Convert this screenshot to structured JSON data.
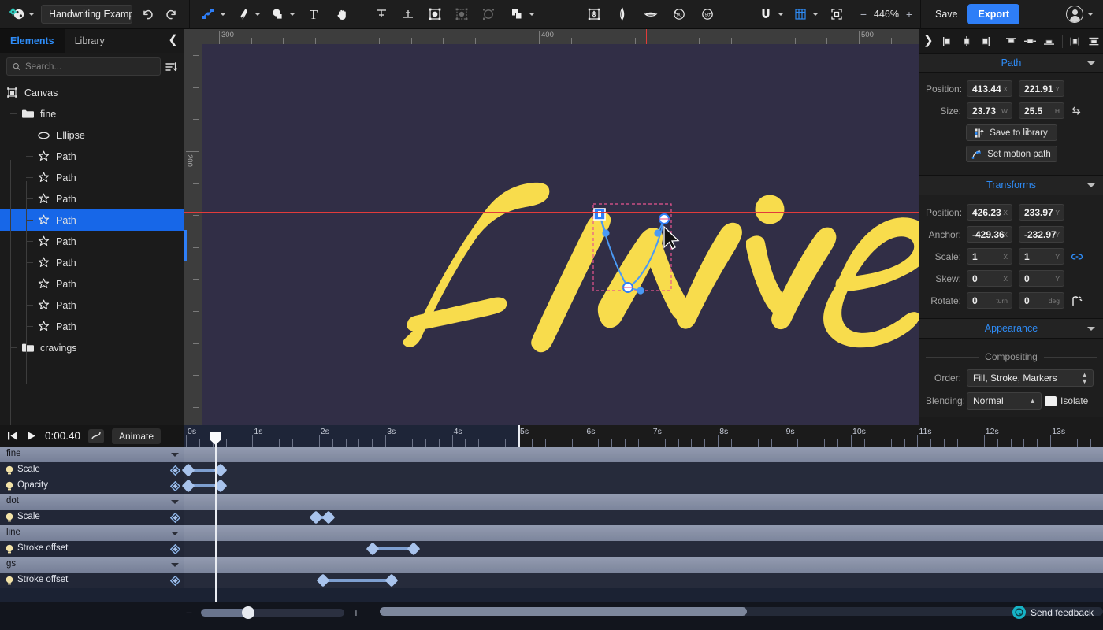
{
  "toolbar": {
    "logo_icon": "app-logo-icon",
    "project_name": "Handwriting Example",
    "undo_icon": "undo-icon",
    "redo_icon": "redo-icon",
    "tools": [
      {
        "name": "node-tool-icon",
        "label": "Node tool"
      },
      {
        "name": "pen-tool-icon",
        "label": "Pen tool"
      },
      {
        "name": "shape-tool-icon",
        "label": "Shape tool"
      },
      {
        "name": "text-tool-icon",
        "label": "Text tool"
      },
      {
        "name": "hand-tool-icon",
        "label": "Hand tool"
      }
    ],
    "path_ops": [
      {
        "name": "align-top-icon"
      },
      {
        "name": "align-bottom-icon"
      },
      {
        "name": "frame-selection-icon"
      },
      {
        "name": "group-selection-icon"
      },
      {
        "name": "mask-selection-icon"
      },
      {
        "name": "boolean-ops-icon"
      }
    ],
    "transform_ops": [
      {
        "name": "anchor-center-icon"
      },
      {
        "name": "flip-horizontal-icon"
      },
      {
        "name": "flip-vertical-icon"
      },
      {
        "name": "rotate-ccw-icon"
      },
      {
        "name": "rotate-cw-icon"
      }
    ],
    "snap_icon": "magnet-snap-icon",
    "grid_icon": "grid-icon",
    "fit_icon": "fit-to-screen-icon",
    "zoom_minus": "−",
    "zoom_level": "446%",
    "zoom_plus": "+",
    "save_label": "Save",
    "export_label": "Export",
    "account_icon": "user-avatar-icon"
  },
  "left_panel": {
    "tabs": [
      {
        "label": "Elements",
        "active": true
      },
      {
        "label": "Library",
        "active": false
      }
    ],
    "collapse_icon": "chevron-left-icon",
    "search": {
      "placeholder": "Search...",
      "value": "",
      "icon": "search-icon"
    },
    "sort_icon": "sort-icon",
    "tree": [
      {
        "label": "Canvas",
        "icon": "canvas-icon",
        "depth": 0,
        "selected": false
      },
      {
        "label": "fine",
        "icon": "folder-icon",
        "depth": 1,
        "selected": false
      },
      {
        "label": "Ellipse",
        "icon": "ellipse-icon",
        "depth": 2,
        "selected": false
      },
      {
        "label": "Path",
        "icon": "path-icon",
        "depth": 2,
        "selected": false
      },
      {
        "label": "Path",
        "icon": "path-icon",
        "depth": 2,
        "selected": false
      },
      {
        "label": "Path",
        "icon": "path-icon",
        "depth": 2,
        "selected": false
      },
      {
        "label": "Path",
        "icon": "path-icon",
        "depth": 2,
        "selected": true
      },
      {
        "label": "Path",
        "icon": "path-icon",
        "depth": 2,
        "selected": false
      },
      {
        "label": "Path",
        "icon": "path-icon",
        "depth": 2,
        "selected": false
      },
      {
        "label": "Path",
        "icon": "path-icon",
        "depth": 2,
        "selected": false
      },
      {
        "label": "Path",
        "icon": "path-icon",
        "depth": 2,
        "selected": false
      },
      {
        "label": "Path",
        "icon": "path-icon",
        "depth": 2,
        "selected": false
      },
      {
        "label": "cravings",
        "icon": "folder-icon",
        "depth": 1,
        "selected": false
      }
    ]
  },
  "canvas": {
    "h_ruler_labels": [
      "300",
      "400",
      "500"
    ],
    "v_ruler_labels": [
      "200"
    ],
    "artboard_color": "#312e46",
    "artwork_text": "FINE",
    "artwork_color": "#f8dc4c",
    "selection_color": "#e8558f",
    "handle_color": "#2e7ef7"
  },
  "right_panel": {
    "expand_icon": "chevron-right-icon",
    "align_buttons": [
      {
        "name": "align-left-icon"
      },
      {
        "name": "align-center-h-icon"
      },
      {
        "name": "align-right-icon"
      },
      {
        "name": "align-top-icon"
      },
      {
        "name": "align-middle-v-icon"
      },
      {
        "name": "align-bottom-icon"
      },
      {
        "name": "distribute-h-icon"
      },
      {
        "name": "distribute-v-icon"
      }
    ],
    "sections": {
      "path": {
        "title": "Path",
        "position_label": "Position:",
        "position_x": "413.44",
        "position_y": "221.91",
        "size_label": "Size:",
        "size_w": "23.73",
        "size_h": "25.5",
        "unit_x": "X",
        "unit_y": "Y",
        "unit_w": "W",
        "unit_h": "H",
        "lock_ratio_icon": "lock-aspect-icon",
        "save_library_label": "Save to library",
        "save_library_icon": "save-library-icon",
        "motion_path_label": "Set motion path",
        "motion_path_icon": "motion-path-icon"
      },
      "transforms": {
        "title": "Transforms",
        "position_label": "Position:",
        "position_x": "426.23",
        "position_y": "233.97",
        "anchor_label": "Anchor:",
        "anchor_x": "-429.36",
        "anchor_y": "-232.97",
        "scale_label": "Scale:",
        "scale_x": "1",
        "scale_y": "1",
        "scale_link_icon": "link-icon",
        "skew_label": "Skew:",
        "skew_x": "0",
        "skew_y": "0",
        "rotate_label": "Rotate:",
        "rotate_turn": "0",
        "rotate_turn_unit": "turn",
        "rotate_deg": "0",
        "rotate_deg_unit": "deg",
        "rotate_icon": "rotate-origin-icon"
      },
      "appearance": {
        "title": "Appearance",
        "compositing_label": "Compositing",
        "order_label": "Order:",
        "order_value": "Fill, Stroke, Markers",
        "blending_label": "Blending:",
        "blending_value": "Normal",
        "isolate_label": "Isolate"
      }
    }
  },
  "timeline": {
    "skip_start_icon": "skip-to-start-icon",
    "play_icon": "play-icon",
    "current_time": "0:00.40",
    "easing_icon": "easing-curve-icon",
    "animate_label": "Animate",
    "ruler_labels": [
      "0s",
      "1s",
      "2s",
      "3s",
      "4s",
      "5s",
      "6s",
      "7s",
      "8s",
      "9s",
      "10s",
      "11s",
      "12s",
      "13s"
    ],
    "composition_end": "5s",
    "playhead_time": "0.40",
    "rows": [
      {
        "type": "group",
        "name": "fine"
      },
      {
        "type": "prop",
        "name": "Scale",
        "keyframes": [
          0.03,
          0.52
        ]
      },
      {
        "type": "prop",
        "name": "Opacity",
        "keyframes": [
          0.03,
          0.52
        ]
      },
      {
        "type": "group",
        "name": "dot"
      },
      {
        "type": "prop",
        "name": "Scale",
        "keyframes": [
          1.96,
          2.14
        ]
      },
      {
        "type": "group",
        "name": "line"
      },
      {
        "type": "prop",
        "name": "Stroke offset",
        "keyframes": [
          2.81,
          3.43
        ]
      },
      {
        "type": "group",
        "name": "gs"
      },
      {
        "type": "prop",
        "name": "Stroke offset",
        "keyframes": [
          2.06,
          3.09
        ]
      }
    ]
  },
  "bottom_bar": {
    "zoom_out_label": "−",
    "zoom_in_label": "+",
    "zoom_value_pct": 33,
    "feedback_label": "Send feedback",
    "feedback_icon": "feedback-icon"
  }
}
